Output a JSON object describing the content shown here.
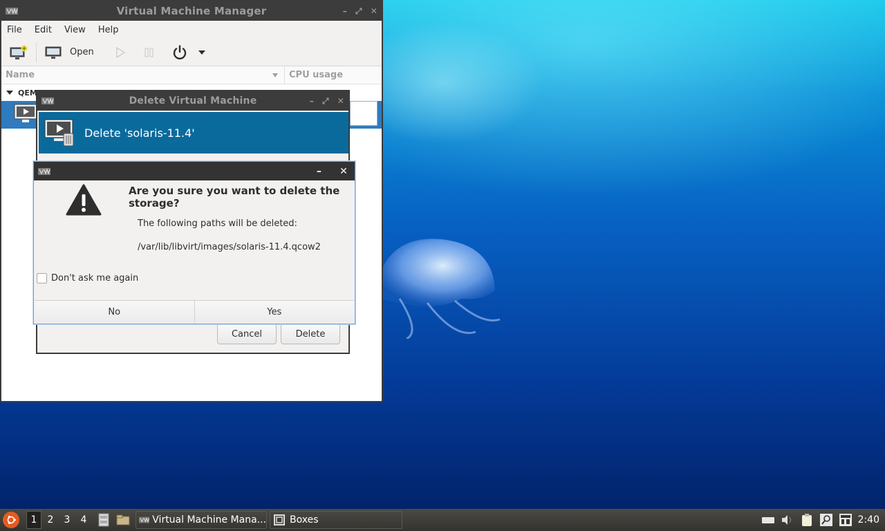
{
  "main_window": {
    "title": "Virtual Machine Manager",
    "menu": [
      "File",
      "Edit",
      "View",
      "Help"
    ],
    "toolbar": {
      "open_label": "Open"
    },
    "columns": {
      "name": "Name",
      "cpu": "CPU usage"
    },
    "group_label": "QEM"
  },
  "delete_dialog": {
    "title": "Delete Virtual Machine",
    "banner_title": "Delete 'solaris-11.4'",
    "cancel_label": "Cancel",
    "delete_label": "Delete"
  },
  "confirm_dialog": {
    "heading": "Are you sure you want to delete the storage?",
    "text": "The following paths will be deleted:",
    "path": "/var/lib/libvirt/images/solaris-11.4.qcow2",
    "checkbox_label": "Don't ask me again",
    "no_label": "No",
    "yes_label": "Yes"
  },
  "taskbar": {
    "workspaces": [
      "1",
      "2",
      "3",
      "4"
    ],
    "tasks": [
      "Virtual Machine Mana...",
      "Boxes"
    ],
    "clock": "2:40"
  },
  "colors": {
    "selection": "#2f7bbf",
    "banner": "#0b6a9c",
    "titlebar": "#3c3c3c"
  }
}
